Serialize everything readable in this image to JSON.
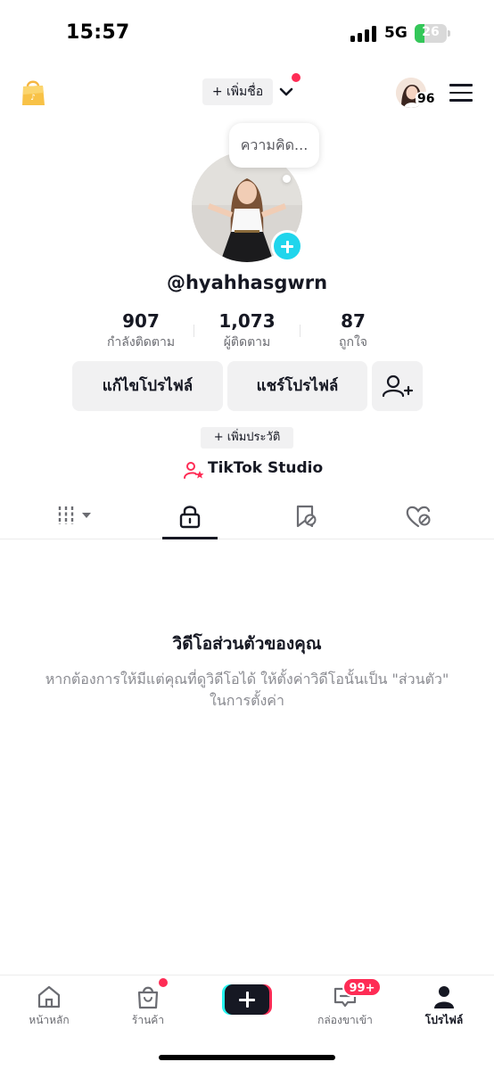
{
  "status_bar": {
    "time": "15:57",
    "network": "5G",
    "battery": "26",
    "battery_level": 0.26
  },
  "header": {
    "add_name_label": "+ เพิ่มชื่อ",
    "friends_count": "96",
    "shop_icon": "shopping-bag-icon",
    "menu_icon": "hamburger-menu-icon"
  },
  "profile": {
    "thought_bubble": "ความคิด...",
    "username": "@hyahhasgwrn",
    "stats": [
      {
        "value": "907",
        "label": "กำลังติดตาม"
      },
      {
        "value": "1,073",
        "label": "ผู้ติดตาม"
      },
      {
        "value": "87",
        "label": "ถูกใจ"
      }
    ],
    "edit_profile_label": "แก้ไขโปรไฟล์",
    "share_profile_label": "แชร์โปรไฟล์",
    "add_bio_label": "+ เพิ่มประวัติ",
    "studio_label": "TikTok Studio"
  },
  "tabs": {
    "active_index": 1,
    "items": [
      "videos-grid-icon",
      "lock-icon",
      "bookmark-icon",
      "liked-heart-icon"
    ]
  },
  "empty_state": {
    "title": "วิดีโอส่วนตัวของคุณ",
    "description": "หากต้องการให้มีแต่คุณที่ดูวิดีโอได้ ให้ตั้งค่าวิดีโอนั้นเป็น \"ส่วนตัว\" ในการตั้งค่า"
  },
  "bottom_nav": {
    "home_label": "หน้าหลัก",
    "shop_label": "ร้านค้า",
    "inbox_label": "กล่องขาเข้า",
    "inbox_badge": "99+",
    "profile_label": "โปรไฟล์",
    "active": "profile"
  },
  "colors": {
    "accent_red": "#fe2c55",
    "accent_cyan": "#20d5ec",
    "text_primary": "#161823",
    "text_secondary": "#8a8b91",
    "button_bg": "#f1f1f2",
    "battery_green": "#34c759"
  }
}
